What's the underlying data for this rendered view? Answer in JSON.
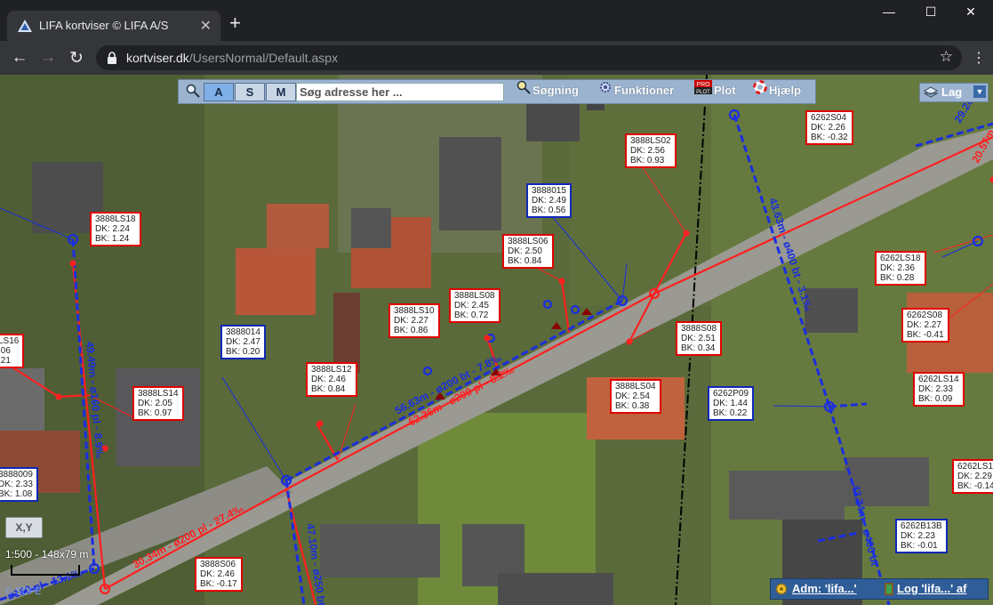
{
  "browser": {
    "tab_title": "LIFA kortviser © LIFA A/S",
    "new_tab": "+",
    "close_tab": "✕",
    "url_domain": "kortviser.dk",
    "url_path": "/UsersNormal/Default.aspx",
    "window_min": "—",
    "window_max": "☐",
    "window_close": "✕"
  },
  "map_toolbar": {
    "mode_a": "A",
    "mode_s": "S",
    "mode_m": "M",
    "search_placeholder": "Søg adresse her ...",
    "sogning": "Søgning",
    "funktioner": "Funktioner",
    "plot": "Plot",
    "hjaelp": "Hjælp",
    "lag": "Lag"
  },
  "labels": [
    {
      "id": "3888LS18",
      "text": "3888LS18\nDK: 2.24\nBK: 1.24",
      "color": "red"
    },
    {
      "id": "3888LS02",
      "text": "3888LS02\nDK: 2.56\nBK: 0.93",
      "color": "red"
    },
    {
      "id": "3888015",
      "text": "3888015\nDK: 2.49\nBK: 0.56",
      "color": "blue"
    },
    {
      "id": "3888LS06",
      "text": "3888LS06\nDK: 2.50\nBK: 0.84",
      "color": "red"
    },
    {
      "id": "3888LS08",
      "text": "3888LS08\nDK: 2.45\nBK: 0.72",
      "color": "red"
    },
    {
      "id": "3888LS10",
      "text": "3888LS10\nDK: 2.27\nBK: 0.86",
      "color": "red"
    },
    {
      "id": "3888014",
      "text": "3888014\nDK: 2.47\nBK: 0.20",
      "color": "blue"
    },
    {
      "id": "3888LS12",
      "text": "3888LS12\nDK: 2.46\nBK: 0.84",
      "color": "red"
    },
    {
      "id": "3888LS14",
      "text": "3888LS14\nDK: 2.05\nBK: 0.97",
      "color": "red"
    },
    {
      "id": "3888LS04",
      "text": "3888LS04\nDK: 2.54\nBK: 0.38",
      "color": "red"
    },
    {
      "id": "3888S08",
      "text": "3888S08\nDK: 2.51\nBK: 0.34",
      "color": "red"
    },
    {
      "id": "6262S04",
      "text": "6262S04\nDK: 2.26\nBK: -0.32",
      "color": "red"
    },
    {
      "id": "6262LS18",
      "text": "6262LS18\nDK: 2.36\nBK: 0.28",
      "color": "red"
    },
    {
      "id": "6262S08",
      "text": "6262S08\nDK: 2.27\nBK: -0.41",
      "color": "red"
    },
    {
      "id": "6262LS14",
      "text": "6262LS14\nDK: 2.33\nBK: 0.09",
      "color": "red"
    },
    {
      "id": "6262P09",
      "text": "6262P09\nDK: 1.44\nBK: 0.22",
      "color": "blue"
    },
    {
      "id": "6262B13B",
      "text": "6262B13B\nDK: 2.23\nBK: -0.01",
      "color": "blue"
    },
    {
      "id": "6262LS1",
      "text": "6262LS1\nDK: 2.29\nBK: -0.14",
      "color": "red"
    },
    {
      "id": "3888S06",
      "text": "3888S06\nDK: 2.46\nBK: -0.17",
      "color": "red"
    },
    {
      "id": "3888009",
      "text": "3888009\nDK: 2.33\nBK: 1.08",
      "color": "blue"
    },
    {
      "id": "LS16",
      "text": "LS16\n.06\n.21",
      "color": "red"
    }
  ],
  "pipes": {
    "p1": "56.63m - ø200 bt - 7.8‰",
    "p2": "62.36m - ø200 pl - 8.2‰",
    "p3": "49.49m - ø160 pl - 8.9‰",
    "p4": "43.63m - ø400 bt - 3.1‰",
    "p5": "30.34m - ø200 pl - 27.4‰",
    "p6": "47.10m - ø250 bt",
    "p7": "43.34m - ø400 bt",
    "p8": "ø160 pl - 13.1‰",
    "p9": "29.28m",
    "p10": "20.57m"
  },
  "map_controls": {
    "xy": "X,Y",
    "scale": "1:500 - 148x79 m",
    "copyright": "© SDFE",
    "adm": "Adm: 'lifa...'",
    "log": "Log 'lifa...' af"
  }
}
